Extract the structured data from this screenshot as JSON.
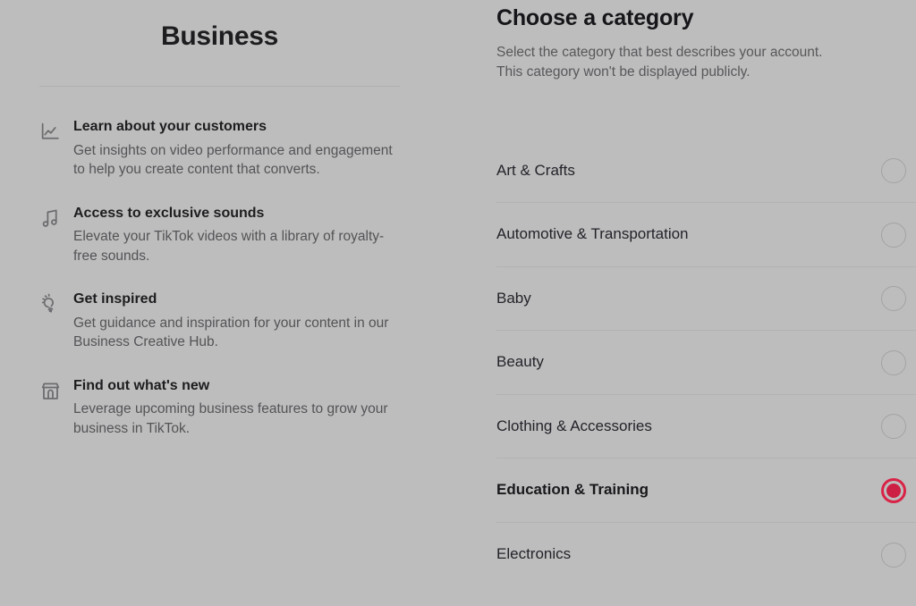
{
  "theme": {
    "page_bg": "#bdbdbd",
    "accent_red": "#CC1F43",
    "highlight_red": "#ED2B45",
    "divider": "#b2b2b2",
    "heading_text": "#16161a",
    "muted_text": "#58585c"
  },
  "left_panel": {
    "title": "Business",
    "benefits": [
      {
        "icon": "line-chart-icon",
        "title": "Learn about your customers",
        "desc": "Get insights on video performance and engagement to help you create content that converts."
      },
      {
        "icon": "music-note-icon",
        "title": "Access to exclusive sounds",
        "desc": "Elevate your TikTok videos with a library of royalty-free sounds."
      },
      {
        "icon": "lightbulb-icon",
        "title": "Get inspired",
        "desc": "Get guidance and inspiration for your content in our Business Creative Hub."
      },
      {
        "icon": "storefront-icon",
        "title": "Find out what's new",
        "desc": "Leverage upcoming business features to grow your business in TikTok."
      }
    ]
  },
  "right_panel": {
    "heading": "Choose a category",
    "subtitle": "Select the category that best describes your account. This category won't be displayed publicly.",
    "selected_category": "Education & Training",
    "categories": [
      {
        "label": "Art & Crafts",
        "selected": false
      },
      {
        "label": "Automotive & Transportation",
        "selected": false
      },
      {
        "label": "Baby",
        "selected": false
      },
      {
        "label": "Beauty",
        "selected": false
      },
      {
        "label": "Clothing & Accessories",
        "selected": false
      },
      {
        "label": "Education & Training",
        "selected": true
      },
      {
        "label": "Electronics",
        "selected": false
      }
    ]
  }
}
